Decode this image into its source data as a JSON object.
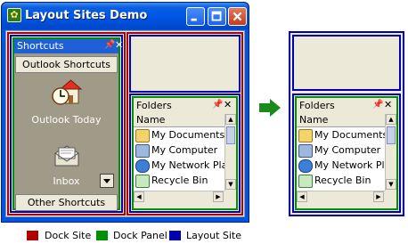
{
  "window": {
    "title": "Layout Sites Demo"
  },
  "shortcuts": {
    "title": "Shortcuts",
    "top_button": "Outlook Shortcuts",
    "items": [
      {
        "label": "Outlook Today",
        "icon": "outlook-today-icon"
      },
      {
        "label": "Inbox",
        "icon": "inbox-icon"
      }
    ],
    "bottom_button": "Other Shortcuts"
  },
  "folders": {
    "title": "Folders",
    "column": "Name",
    "items": [
      {
        "label": "My Documents",
        "icon": "my-documents-icon"
      },
      {
        "label": "My Computer",
        "icon": "my-computer-icon"
      },
      {
        "label": "My Network Pla",
        "icon": "network-places-icon"
      },
      {
        "label": "Recycle Bin",
        "icon": "recycle-bin-icon"
      }
    ]
  },
  "legend": [
    {
      "label": "Dock Site",
      "color": "#b00000"
    },
    {
      "label": "Dock Panel",
      "color": "#009000"
    },
    {
      "label": "Layout Site",
      "color": "#0000b0"
    }
  ],
  "colors": {
    "arrow": "#1a8a1a",
    "titlebar": "#0055e5"
  }
}
